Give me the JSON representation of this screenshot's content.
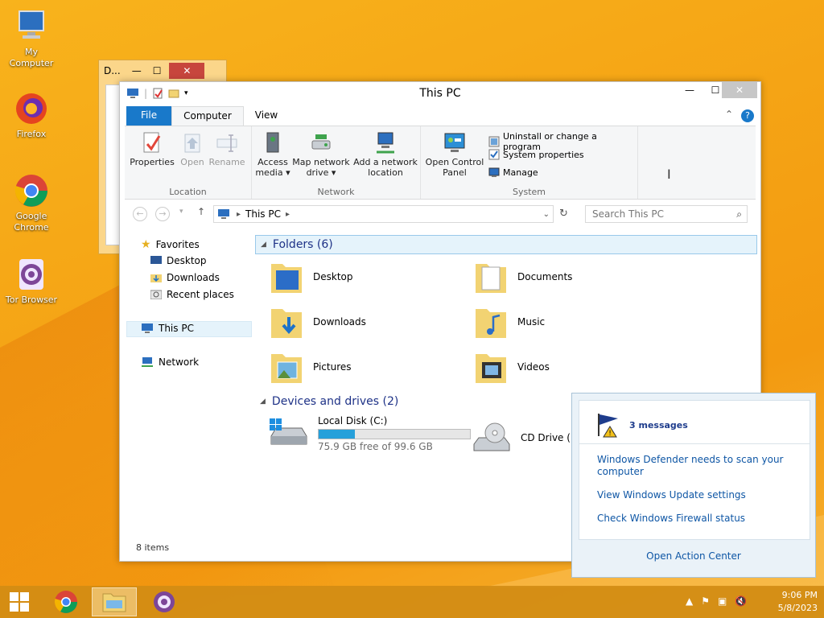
{
  "desktop": {
    "icons": [
      {
        "label": "My Computer",
        "icon": "my-computer-icon"
      },
      {
        "label": "Firefox",
        "icon": "firefox-icon"
      },
      {
        "label": "Google Chrome",
        "icon": "chrome-icon"
      },
      {
        "label": "Tor Browser",
        "icon": "tor-browser-icon"
      }
    ],
    "back_window_title": "D..."
  },
  "window": {
    "title": "This PC",
    "tabs": {
      "file": "File",
      "computer": "Computer",
      "view": "View"
    },
    "ribbon": {
      "location": {
        "label": "Location",
        "properties": "Properties",
        "open": "Open",
        "rename": "Rename"
      },
      "network": {
        "label": "Network",
        "access_media": "Access media",
        "map_network_drive": "Map network drive",
        "add_network_location": "Add a network location"
      },
      "system": {
        "label": "System",
        "open_control_panel": "Open Control Panel",
        "uninstall": "Uninstall or change a program",
        "system_properties": "System properties",
        "manage": "Manage"
      }
    },
    "address": {
      "path": "This PC",
      "search_placeholder": "Search This PC"
    },
    "nav": {
      "favorites": "Favorites",
      "desktop": "Desktop",
      "downloads": "Downloads",
      "recent_places": "Recent places",
      "this_pc": "This PC",
      "network": "Network"
    },
    "folders_header": "Folders (6)",
    "folders": [
      "Desktop",
      "Documents",
      "Downloads",
      "Music",
      "Pictures",
      "Videos"
    ],
    "devices_header": "Devices and drives (2)",
    "drives": {
      "c_label": "Local Disk (C:)",
      "c_free": "75.9 GB free of 99.6 GB",
      "c_used_fraction": 0.24,
      "d_label": "CD Drive (D:)"
    },
    "status": "8 items"
  },
  "action_center": {
    "title": "3 messages",
    "links": [
      "Windows Defender needs to scan your computer",
      "View Windows Update settings",
      "Check Windows Firewall status"
    ],
    "open": "Open Action Center"
  },
  "taskbar": {
    "time": "9:06 PM",
    "date": "5/8/2023"
  }
}
